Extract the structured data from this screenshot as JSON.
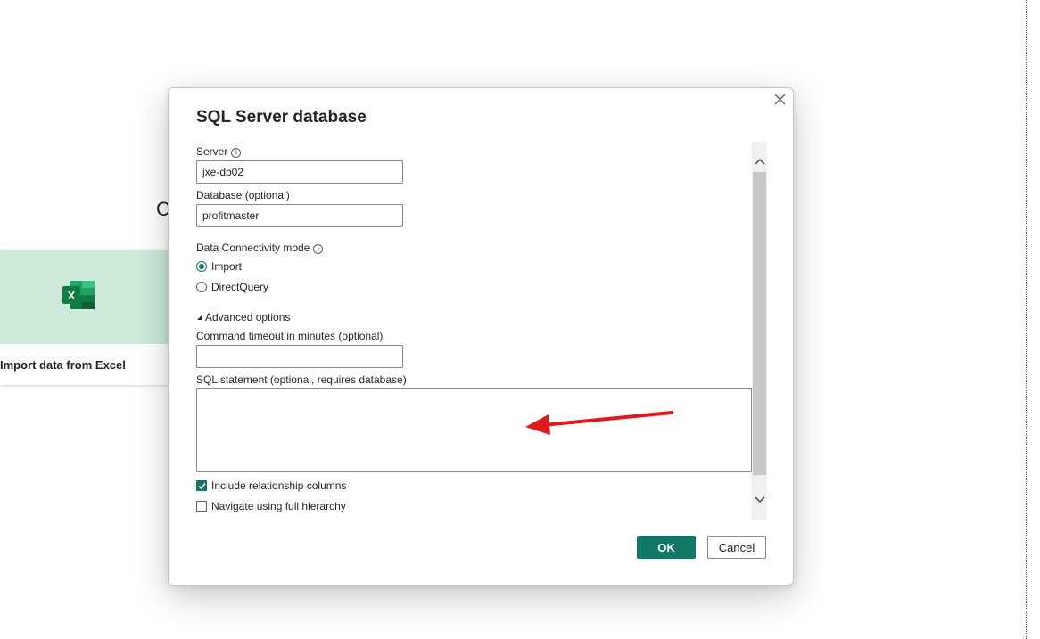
{
  "background": {
    "heading_fragment": "C",
    "excel_card": {
      "label": "Import data from Excel",
      "icon": "excel-icon",
      "tint_color": "#cdeadb"
    }
  },
  "dialog": {
    "title": "SQL Server database",
    "close_icon": "close-icon",
    "server": {
      "label": "Server",
      "value": "jxe-db02",
      "info_icon": "info-icon"
    },
    "database": {
      "label": "Database (optional)",
      "value": "profitmaster"
    },
    "connectivity": {
      "label": "Data Connectivity mode",
      "info_icon": "info-icon",
      "options": [
        {
          "label": "Import",
          "selected": true
        },
        {
          "label": "DirectQuery",
          "selected": false
        }
      ]
    },
    "advanced": {
      "toggle_label": "Advanced options",
      "expanded": true,
      "timeout": {
        "label": "Command timeout in minutes (optional)",
        "value": ""
      },
      "sql": {
        "label": "SQL statement (optional, requires database)",
        "value": ""
      },
      "checkboxes": [
        {
          "label": "Include relationship columns",
          "checked": true
        },
        {
          "label": "Navigate using full hierarchy",
          "checked": false
        }
      ]
    },
    "buttons": {
      "ok": "OK",
      "cancel": "Cancel"
    },
    "accent_color": "#117865",
    "annotation_color": "#e0191c"
  }
}
